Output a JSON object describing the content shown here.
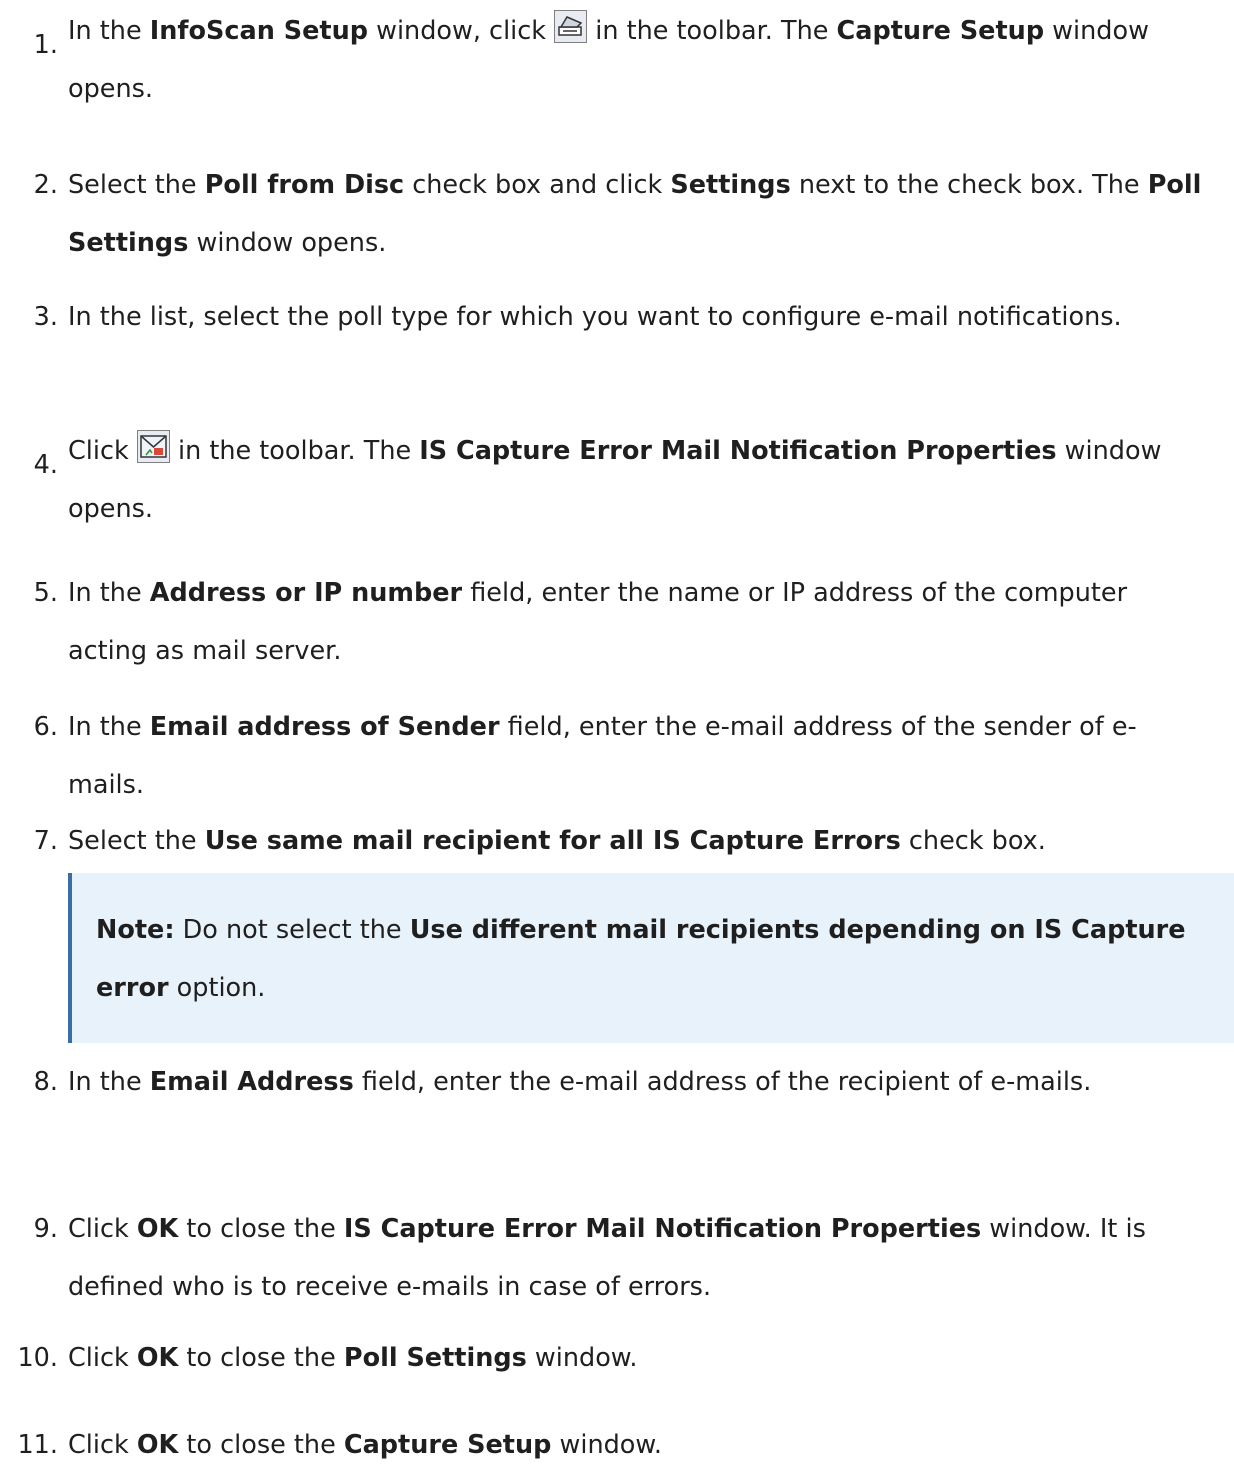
{
  "steps": [
    {
      "num": "1.",
      "parts": [
        "In the ",
        "InfoScan Setup",
        " window, click ",
        " in the toolbar. The ",
        "Capture Setup",
        " window opens."
      ],
      "icon": "capture-setup-toolbar-icon"
    },
    {
      "num": "2.",
      "parts": [
        "Select the ",
        "Poll from Disc",
        " check box and click ",
        "Settings",
        " next to the check box. The ",
        "Poll Settings",
        " window opens."
      ]
    },
    {
      "num": "3.",
      "parts": [
        "In the list, select the poll type for which you want to configure e-mail notifications."
      ]
    },
    {
      "num": "4.",
      "parts": [
        "Click ",
        " in the toolbar. The ",
        "IS Capture Error Mail Notification Properties",
        " window opens."
      ],
      "icon": "mail-notification-toolbar-icon"
    },
    {
      "num": "5.",
      "parts": [
        "In the ",
        "Address or IP number",
        " field, enter the name or IP address of the computer acting as mail server."
      ]
    },
    {
      "num": "6.",
      "parts": [
        "In the ",
        "Email address of Sender",
        " field, enter the e-mail address of the sender of e-mails."
      ]
    },
    {
      "num": "7.",
      "parts": [
        "Select the ",
        "Use same mail recipient for all IS Capture Errors",
        " check box."
      ]
    },
    {
      "num": "8.",
      "parts": [
        "In the ",
        "Email Address",
        " field, enter the e-mail address of the recipient of e-mails."
      ]
    },
    {
      "num": "9.",
      "parts": [
        "Click ",
        "OK",
        " to close the ",
        "IS Capture Error Mail Notification Properties",
        " window. It is defined who is to receive e-mails in case of errors."
      ]
    },
    {
      "num": "10.",
      "parts": [
        "Click ",
        "OK",
        " to close the ",
        "Poll Settings",
        " window."
      ]
    },
    {
      "num": "11.",
      "parts": [
        "Click ",
        "OK",
        " to close the ",
        "Capture Setup",
        " window."
      ]
    }
  ],
  "note": {
    "label": "Note:",
    "parts": [
      " Do not select the ",
      "Use different mail recipients depending on IS Capture error",
      " option."
    ]
  },
  "colors": {
    "note_bg": "#e8f2fb",
    "note_border": "#3a6ea5",
    "text": "#1f1f1f"
  }
}
